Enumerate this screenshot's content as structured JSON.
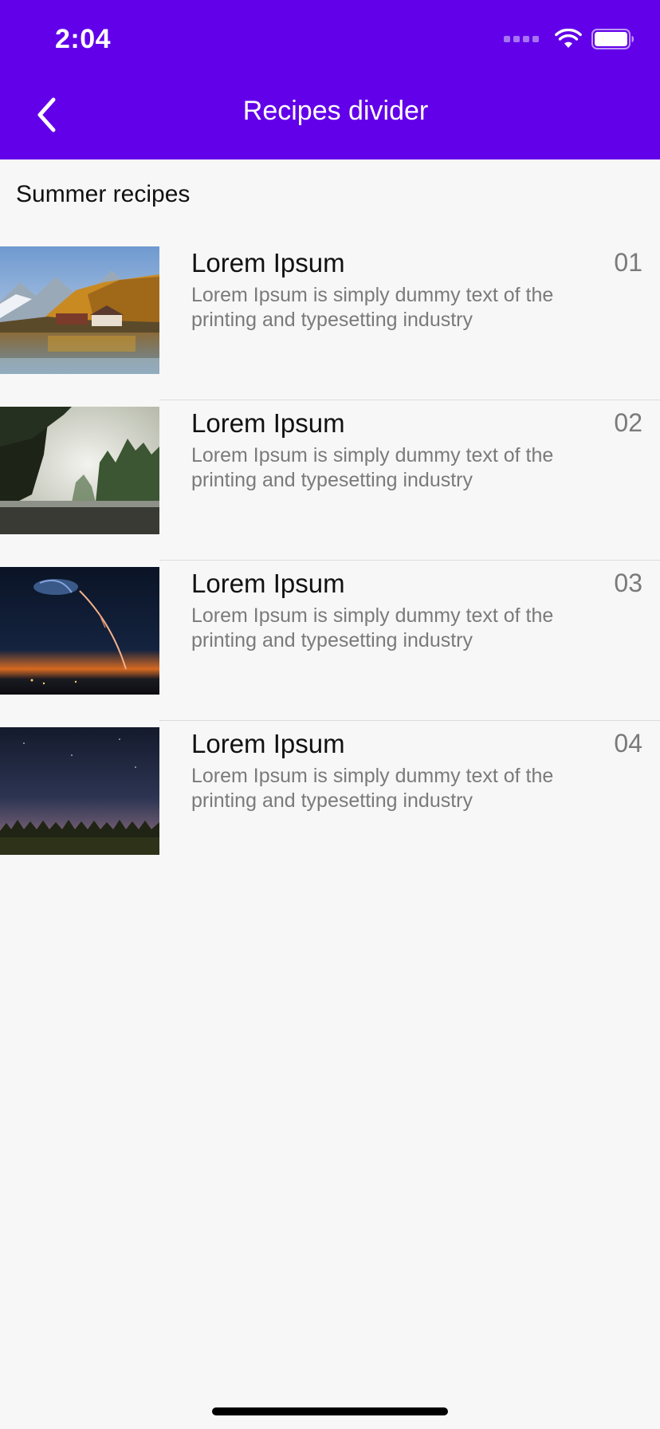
{
  "status_bar": {
    "time": "2:04"
  },
  "nav": {
    "title": "Recipes divider",
    "back_icon": "chevron-left-icon"
  },
  "section": {
    "title": "Summer recipes"
  },
  "items": [
    {
      "title": "Lorem Ipsum",
      "description": "Lorem Ipsum is simply dummy text of the printing and typesetting industry",
      "number": "01",
      "image": "lake-cabin-autumn"
    },
    {
      "title": "Lorem Ipsum",
      "description": "Lorem Ipsum is simply dummy text of the printing and typesetting industry",
      "number": "02",
      "image": "misty-forest"
    },
    {
      "title": "Lorem Ipsum",
      "description": "Lorem Ipsum is simply dummy text of the printing and typesetting industry",
      "number": "03",
      "image": "night-sky-rocket"
    },
    {
      "title": "Lorem Ipsum",
      "description": "Lorem Ipsum is simply dummy text of the printing and typesetting industry",
      "number": "04",
      "image": "starry-field"
    }
  ],
  "colors": {
    "primary": "#6200ea",
    "background": "#f7f7f7",
    "secondary_text": "#7a7a7a",
    "divider": "#dcdcdc"
  }
}
